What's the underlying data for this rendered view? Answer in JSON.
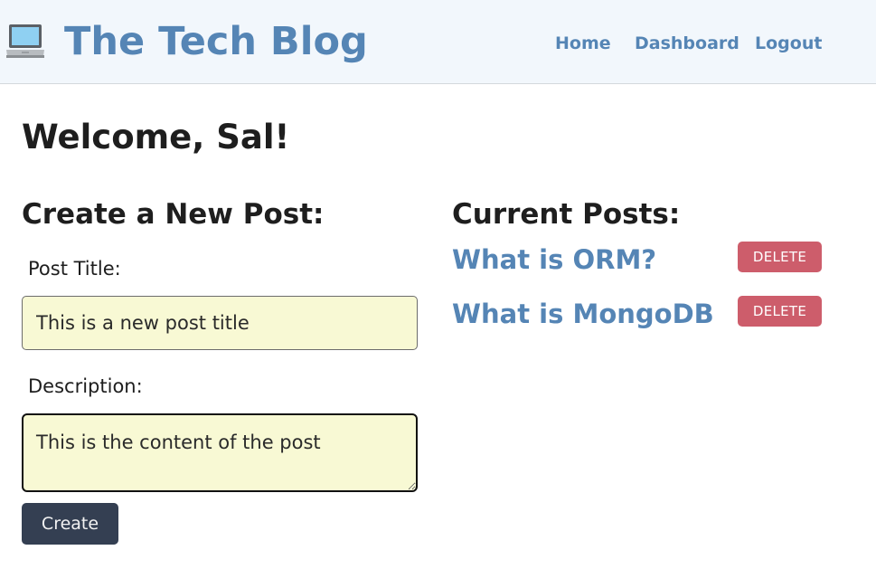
{
  "header": {
    "logo_icon": "laptop-icon",
    "title": "The Tech Blog",
    "brand_color": "#5585b5",
    "nav": [
      {
        "label": "Home"
      },
      {
        "label": "Dashboard"
      },
      {
        "label": "Logout"
      }
    ]
  },
  "welcome": "Welcome, Sal!",
  "create_post": {
    "heading": "Create a New Post:",
    "title_label": "Post Title:",
    "title_value": "This is a new post title",
    "description_label": "Description:",
    "description_value": "This is the content of the post",
    "input_bg_color": "#f8f9d4",
    "create_label": "Create"
  },
  "current_posts": {
    "heading": "Current Posts:",
    "posts": [
      {
        "title": "What is ORM?",
        "delete_label": "DELETE"
      },
      {
        "title": "What is MongoDB",
        "delete_label": "DELETE"
      }
    ],
    "delete_color": "#cd5d6b"
  }
}
